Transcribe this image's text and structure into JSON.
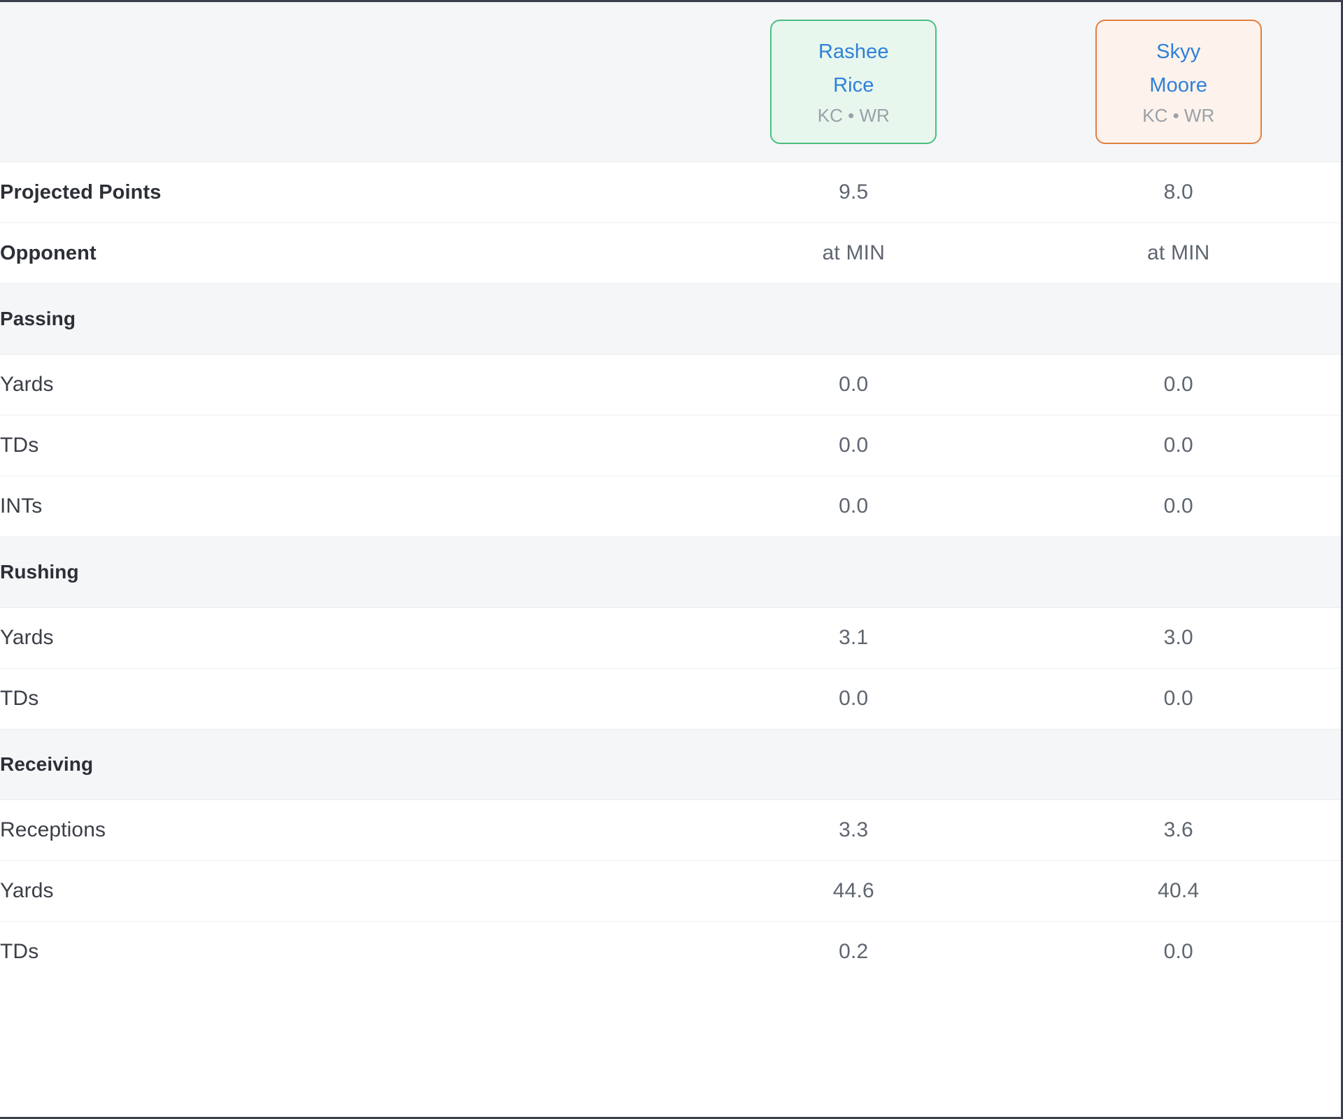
{
  "table": {
    "players": [
      {
        "first_name": "Rashee",
        "last_name": "Rice",
        "meta": "KC • WR",
        "accent_color": "#4cbe7f",
        "accent_bg": "#e7f7ee",
        "name_color": "#2f80d8"
      },
      {
        "first_name": "Skyy",
        "last_name": "Moore",
        "meta": "KC • WR",
        "accent_color": "#e0803f",
        "accent_bg": "#fdf3ec",
        "name_color": "#2f80d8"
      }
    ],
    "top_rows": [
      {
        "label": "Projected Points",
        "bold": true,
        "values": [
          "9.5",
          "8.0"
        ]
      },
      {
        "label": "Opponent",
        "bold": true,
        "values": [
          "at MIN",
          "at MIN"
        ]
      }
    ],
    "sections": [
      {
        "title": "Passing",
        "rows": [
          {
            "label": "Yards",
            "values": [
              "0.0",
              "0.0"
            ]
          },
          {
            "label": "TDs",
            "values": [
              "0.0",
              "0.0"
            ]
          },
          {
            "label": "INTs",
            "values": [
              "0.0",
              "0.0"
            ]
          }
        ]
      },
      {
        "title": "Rushing",
        "rows": [
          {
            "label": "Yards",
            "values": [
              "3.1",
              "3.0"
            ]
          },
          {
            "label": "TDs",
            "values": [
              "0.0",
              "0.0"
            ]
          }
        ]
      },
      {
        "title": "Receiving",
        "rows": [
          {
            "label": "Receptions",
            "values": [
              "3.3",
              "3.6"
            ]
          },
          {
            "label": "Yards",
            "values": [
              "44.6",
              "40.4"
            ]
          },
          {
            "label": "TDs",
            "values": [
              "0.2",
              "0.0"
            ]
          }
        ]
      }
    ]
  }
}
